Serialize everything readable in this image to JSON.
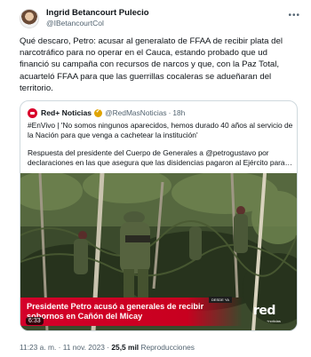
{
  "author": {
    "name": "Ingrid Betancourt Pulecio",
    "handle": "@IBetancourtCol"
  },
  "more_icon": "more-dots",
  "text": "Qué descaro, Petro: acusar al generalato de FFAA de recibir plata del narcotráfico para no operar en el Cauca, estando probado que ud financió su campaña con recursos de narcos y que, con la Paz Total, acuarteló FFAA para que las guerrillas cocaleras se adueñaran del territorio.",
  "quoted": {
    "name": "Red+ Noticias",
    "verified_color": "#e0a400",
    "handle": "@RedMasNoticias",
    "separator": "·",
    "time": "18h",
    "text1": "#EnVivo | 'No somos ningunos aparecidos, hemos durado 40 años al servicio de la Nación para que venga a cachetear la institución'",
    "text2": "Respuesta del presidente del Cuerpo de Generales a @petrogustavo por declaraciones en las que asegura que las disidencias pagaron al Ejército para…",
    "video": {
      "caption": "Presidente Petro acusó a generales de recibir sobornos en Cañón del Micay",
      "logo": "red",
      "logo_sub": "+noticias",
      "live_tag": "DESDE YA",
      "duration": "6:33",
      "accent_color": "#d4002a"
    }
  },
  "footer": {
    "time": "11:23 a. m.",
    "sep1": "·",
    "date": "11 nov. 2023",
    "sep2": "·",
    "views": "25,5 mil",
    "views_label": "Reproducciones"
  }
}
